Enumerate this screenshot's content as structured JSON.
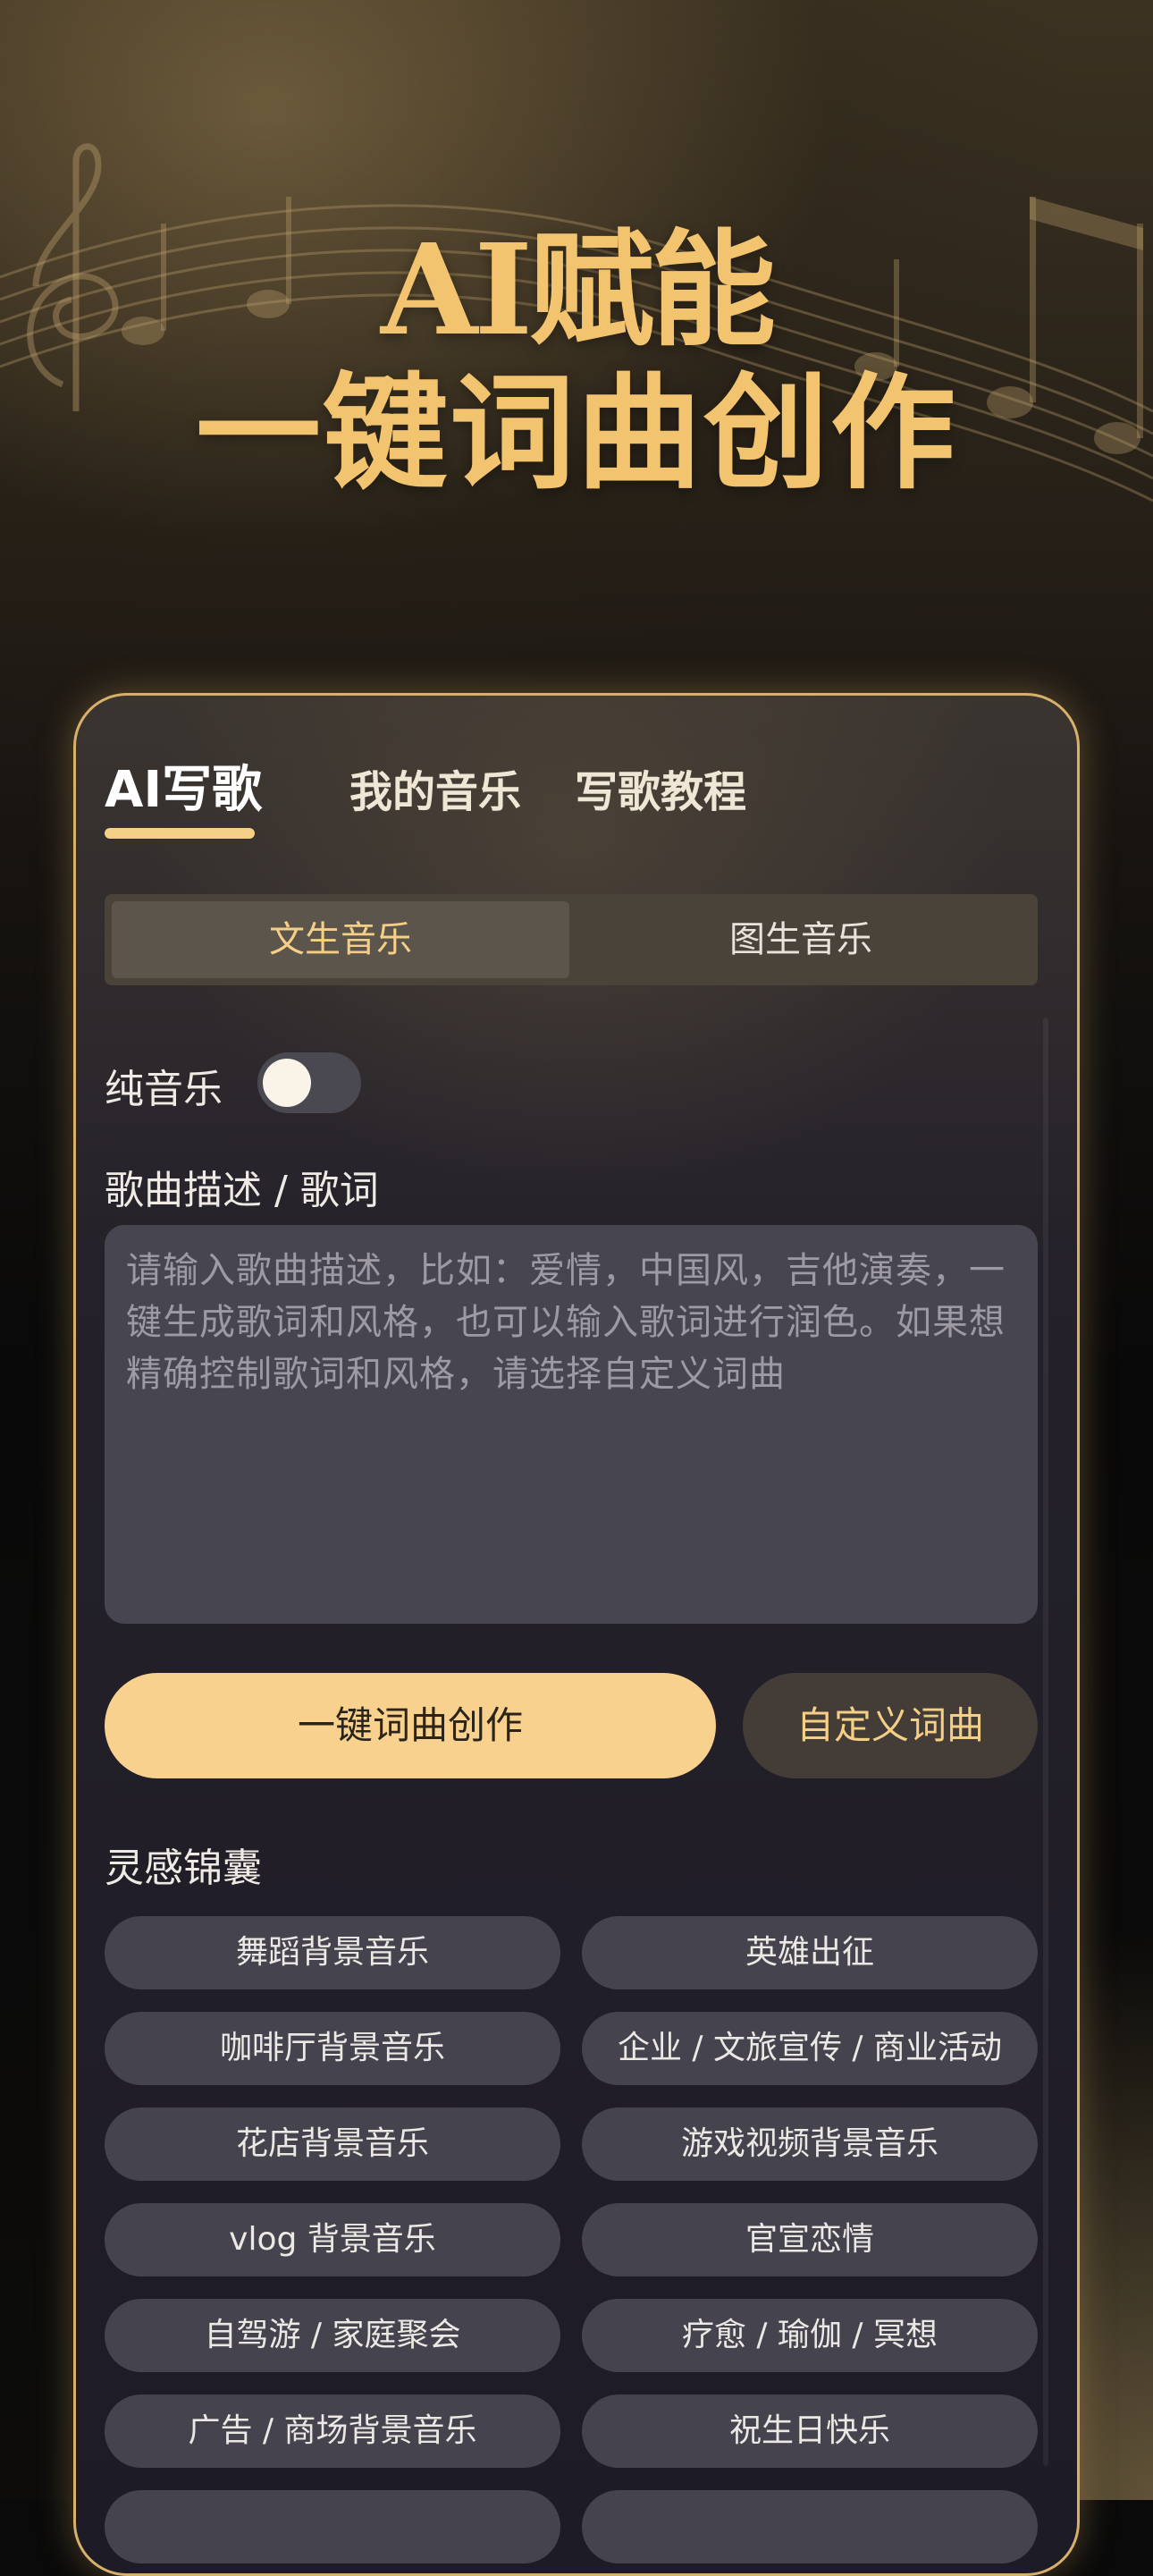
{
  "hero": {
    "line1": "AI赋能",
    "line2": "一键词曲创作"
  },
  "tabs": [
    {
      "label": "AI写歌",
      "active": true
    },
    {
      "label": "我的音乐",
      "active": false
    },
    {
      "label": "写歌教程",
      "active": false
    }
  ],
  "segment": {
    "options": [
      "文生音乐",
      "图生音乐"
    ],
    "selected": "文生音乐"
  },
  "pure_music": {
    "label": "纯音乐",
    "enabled": false
  },
  "description": {
    "label": "歌曲描述 / 歌词",
    "value": "",
    "placeholder": "请输入歌曲描述，比如：爱情，中国风，吉他演奏，一键生成歌词和风格，也可以输入歌词进行润色。如果想精确控制歌词和风格，请选择自定义词曲"
  },
  "actions": {
    "create": "一键词曲创作",
    "custom": "自定义词曲"
  },
  "inspiration": {
    "title": "灵感锦囊",
    "chips": [
      "舞蹈背景音乐",
      "英雄出征",
      "咖啡厅背景音乐",
      "企业 / 文旅宣传 / 商业活动",
      "花店背景音乐",
      "游戏视频背景音乐",
      "vlog 背景音乐",
      "官宣恋情",
      "自驾游 / 家庭聚会",
      "疗愈 / 瑜伽 / 冥想",
      "广告 / 商场背景音乐",
      "祝生日快乐"
    ]
  },
  "colors": {
    "accent": "#f6cf87",
    "hero_gold": "#f3c46f",
    "card_border": "#d8b06a",
    "chip_bg": "#45434e"
  }
}
